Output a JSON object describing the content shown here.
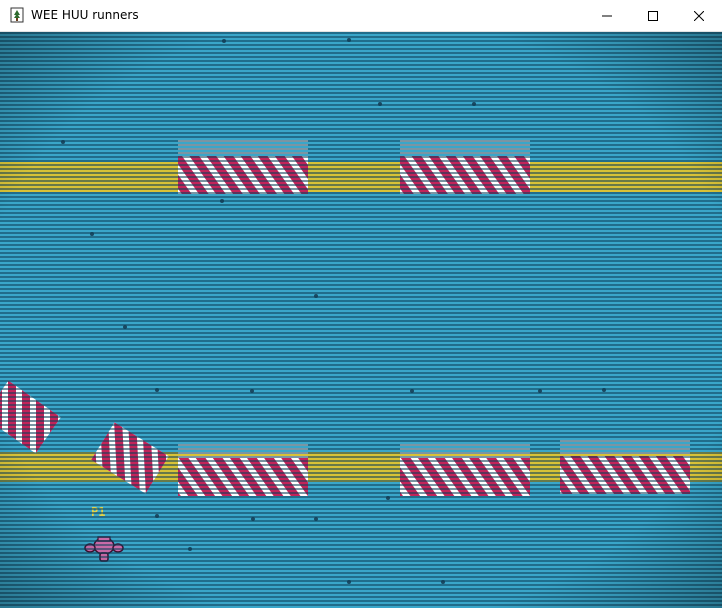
{
  "window": {
    "title": "WEE HUU runners",
    "icon": "tree-app-icon",
    "controls": [
      "minimize-icon",
      "maximize-icon",
      "close-icon"
    ]
  },
  "game": {
    "player": {
      "label": "P1",
      "icon": "pink-runner-icon"
    },
    "colors": {
      "background": "#3aa6c9",
      "scanline": "#0d3d57",
      "track": "#d8c237",
      "barrier_stripe": "#c2245a",
      "barrier_base": "#ffffff",
      "player_label": "#e0d24a",
      "player": "#c96ba8"
    }
  }
}
